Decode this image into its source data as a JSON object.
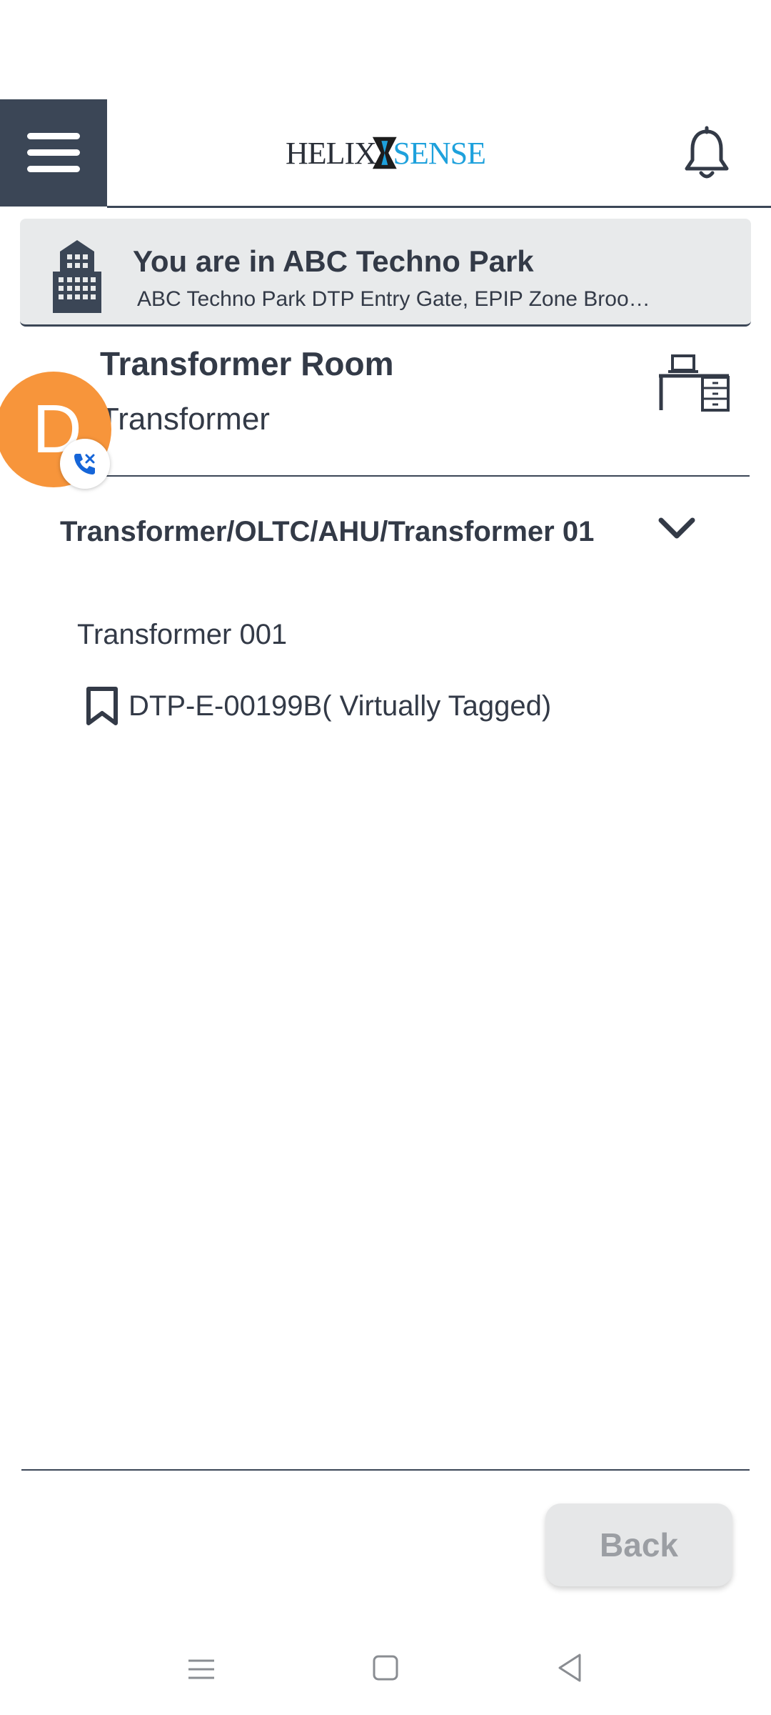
{
  "header": {
    "logo_left": "HELIX",
    "logo_right": "SENSE",
    "menu_icon": "hamburger-menu-icon",
    "notification_icon": "bell-icon"
  },
  "location": {
    "title": "You are in ABC Techno Park",
    "address": "ABC Techno Park DTP Entry Gate, EPIP Zone Brookefi...",
    "icon": "building-icon"
  },
  "room": {
    "title": "Transformer Room",
    "subtitle": "Transformer",
    "icon": "desk-icon"
  },
  "avatar": {
    "letter": "D",
    "badge_icon": "phone-call-icon",
    "color": "#f7953b"
  },
  "asset": {
    "path": "Transformer/OLTC/AHU/Transformer 01",
    "name": "Transformer 001",
    "tag": "DTP-E-00199B( Virtually Tagged)",
    "expand_icon": "chevron-down-icon",
    "tag_icon": "bookmark-icon"
  },
  "footer": {
    "back_label": "Back"
  },
  "colors": {
    "primary_dark": "#3b4656",
    "brand_blue": "#1ea1dc",
    "banner_bg": "#e8eaeb"
  }
}
